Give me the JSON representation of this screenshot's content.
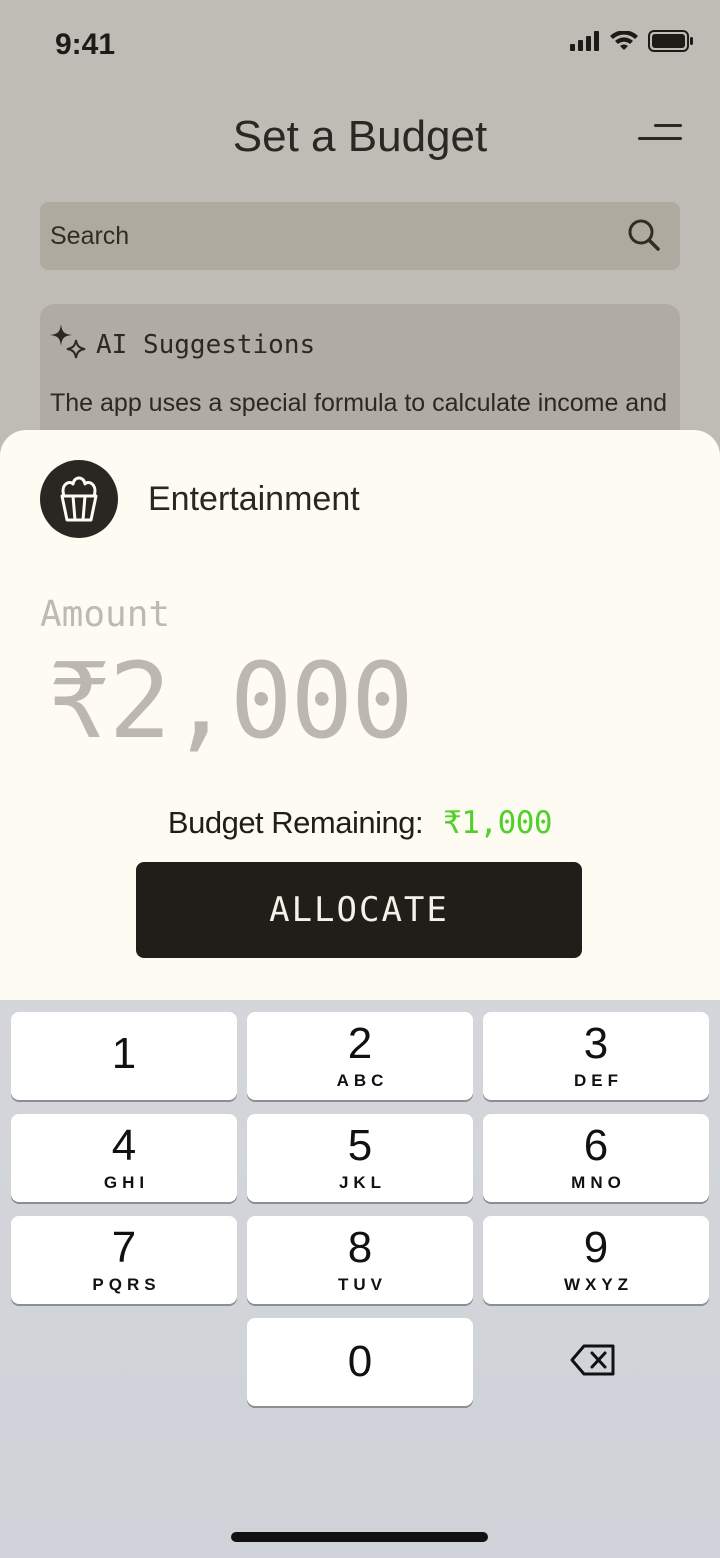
{
  "status_bar": {
    "time": "9:41"
  },
  "header": {
    "title": "Set a Budget"
  },
  "search": {
    "placeholder": "Search"
  },
  "ai_card": {
    "title": "AI Suggestions",
    "body": "The app uses a special formula to calculate income and expected income in the future. We recommend using th"
  },
  "sheet": {
    "category_name": "Entertainment",
    "amount_label": "Amount",
    "amount_value": "₹2,000",
    "remaining_label": "Budget Remaining:",
    "remaining_value": "₹1,000",
    "allocate_label": "ALLOCATE"
  },
  "keypad": {
    "keys": [
      {
        "digit": "1",
        "letters": ""
      },
      {
        "digit": "2",
        "letters": "ABC"
      },
      {
        "digit": "3",
        "letters": "DEF"
      },
      {
        "digit": "4",
        "letters": "GHI"
      },
      {
        "digit": "5",
        "letters": "JKL"
      },
      {
        "digit": "6",
        "letters": "MNO"
      },
      {
        "digit": "7",
        "letters": "PQRS"
      },
      {
        "digit": "8",
        "letters": "TUV"
      },
      {
        "digit": "9",
        "letters": "WXYZ"
      },
      {
        "digit": "0",
        "letters": ""
      }
    ]
  },
  "colors": {
    "accent_green": "#4fd12a",
    "dark": "#201e18",
    "sheet_bg": "#fefbf3"
  },
  "icons": [
    "signal-icon",
    "wifi-icon",
    "battery-icon",
    "menu-icon",
    "search-icon",
    "sparkle-icon",
    "popcorn-icon",
    "backspace-icon"
  ]
}
